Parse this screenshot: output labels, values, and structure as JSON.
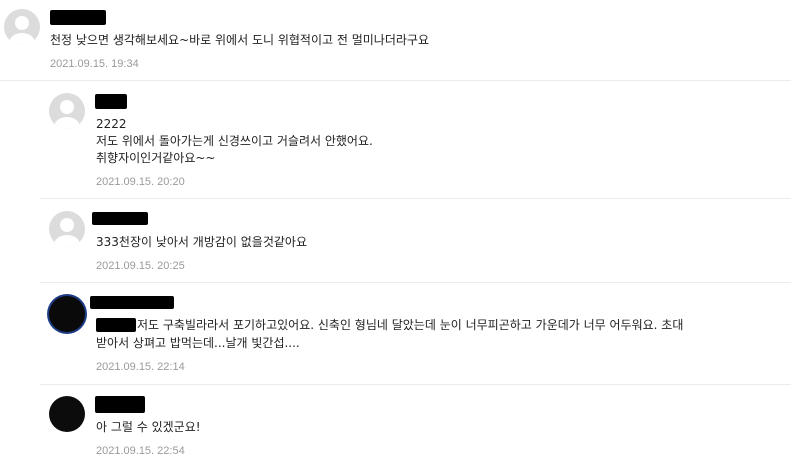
{
  "comments": [
    {
      "lines": [
        "천정 낮으면 생각해보세요~바로 위에서 도니 위협적이고 전 멀미나더라구요"
      ],
      "date": "2021.09.15. 19:34"
    },
    {
      "lines": [
        "2222",
        "저도 위에서 돌아가는게 신경쓰이고 거슬려서 안했어요.",
        "취향자이인거같아요~~"
      ],
      "date": "2021.09.15. 20:20"
    },
    {
      "lines": [
        "333천장이 낮아서 개방감이 없을것같아요"
      ],
      "date": "2021.09.15. 20:25"
    },
    {
      "lines": [
        "저도 구축빌라라서 포기하고있어요. 신축인 형님네 달았는데 눈이 너무피곤하고 가운데가 너무 어두워요. 초대",
        "받아서 상펴고 밥먹는데...날개 빛간섭...."
      ],
      "date": "2021.09.15. 22:14"
    },
    {
      "lines": [
        "아 그럴 수 있겠군요!"
      ],
      "date": "2021.09.15. 22:54"
    }
  ]
}
